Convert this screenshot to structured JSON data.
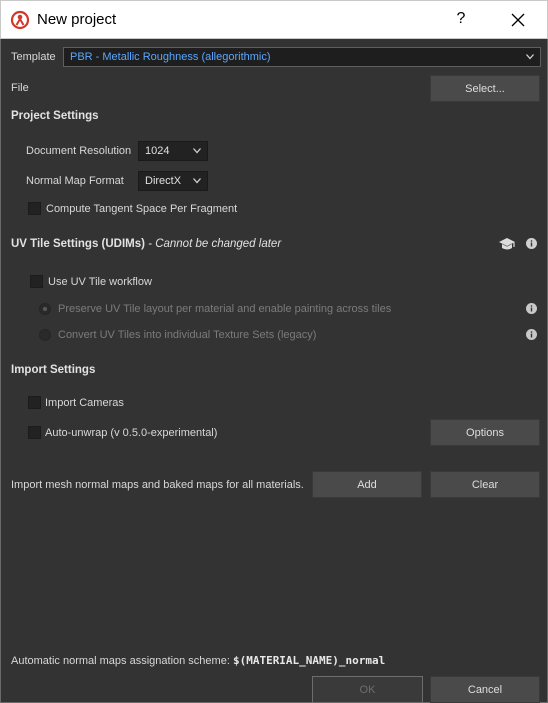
{
  "window": {
    "title": "New project",
    "help": "?",
    "icons": {
      "app": "substance-painter-logo-icon",
      "close": "close-icon"
    }
  },
  "template": {
    "label": "Template",
    "value": "PBR - Metallic Roughness (allegorithmic)"
  },
  "file": {
    "label": "File",
    "select_label": "Select..."
  },
  "project_settings": {
    "heading": "Project Settings",
    "doc_res_label": "Document Resolution",
    "doc_res_value": "1024",
    "normal_map_label": "Normal Map Format",
    "normal_map_value": "DirectX",
    "compute_tangent_label": "Compute Tangent Space Per Fragment"
  },
  "uv_tile_settings": {
    "heading": "UV Tile Settings (UDIMs)",
    "heading_note": " - Cannot be changed later",
    "use_uv_label": "Use UV Tile workflow",
    "preserve_label": "Preserve UV Tile layout per material and enable painting across tiles",
    "convert_label": "Convert UV Tiles into individual Texture Sets (legacy)"
  },
  "import_settings": {
    "heading": "Import Settings",
    "import_cameras_label": "Import Cameras",
    "auto_unwrap_label": "Auto-unwrap (v 0.5.0-experimental)",
    "options_label": "Options"
  },
  "normal_maps": {
    "description": "Import mesh normal maps and baked maps for all materials.",
    "add_label": "Add",
    "clear_label": "Clear",
    "scheme_label": "Automatic normal maps assignation scheme:",
    "scheme_value": "$(MATERIAL_NAME)_normal"
  },
  "footer": {
    "ok_label": "OK",
    "cancel_label": "Cancel"
  },
  "colors": {
    "background": "#333333",
    "accent_link": "#5aa7ff",
    "button": "#4a4a4a"
  }
}
